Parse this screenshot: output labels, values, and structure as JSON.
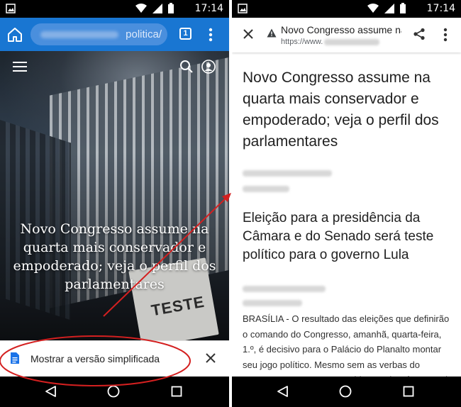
{
  "status_bar": {
    "time": "17:14"
  },
  "browser": {
    "url_visible_text": "politica/",
    "tab_count": "1",
    "hero_headline": "Novo Congresso assume na quarta mais conservador e empoderado; veja o perfil dos parlamentares",
    "sign_text": "TESTE",
    "simplified_view_label": "Mostrar a versão simplificada"
  },
  "reader": {
    "toolbar_title": "Novo Congresso assume na quarta mais conservador e empoderado; veja o perfil dos parlamentares",
    "toolbar_url_prefix": "https://www.",
    "headline": "Novo Congresso assume na quarta mais conservador e empoderado; veja o perfil dos parlamentares",
    "subheadline": "Eleição para a presidência da Câmara e do Senado será teste político para o governo Lula",
    "paragraph": "BRASÍLIA - O resultado das eleições que definirão o comando do Congresso, amanhã, quarta-feira, 1.º, é decisivo para o Palácio do Planalto montar seu jogo político. Mesmo sem as verbas do orçamento secreto, os presidentes da Câmara e do Senado"
  },
  "colors": {
    "toolbar_blue": "#1976d2",
    "annotation_red": "#d42020",
    "status_black": "#000000"
  },
  "icons": [
    "home-icon",
    "tab-switcher-icon",
    "more-vert-icon",
    "menu-icon",
    "search-icon",
    "account-icon",
    "document-icon",
    "close-icon",
    "back-icon",
    "home-nav-icon",
    "recents-icon",
    "warning-icon",
    "share-icon"
  ]
}
